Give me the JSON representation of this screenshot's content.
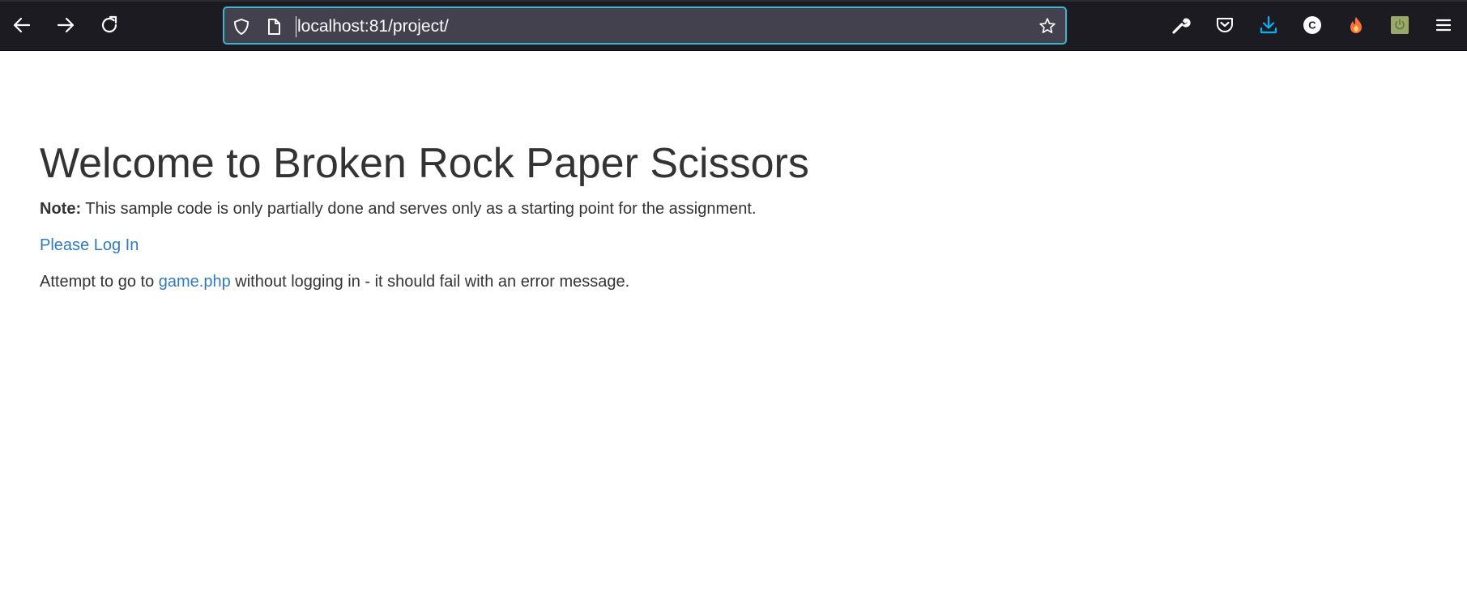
{
  "browser": {
    "url": "localhost:81/project/",
    "icons": {
      "back": "arrow-left-icon",
      "forward": "arrow-right-icon",
      "reload": "reload-icon",
      "shield": "shield-icon",
      "page": "page-icon",
      "bookmark": "star-icon",
      "tools": "wrench-icon",
      "pocket": "pocket-icon",
      "downloads": "download-icon",
      "extension_c": "c-extension-icon",
      "extension_fire": "fire-extension-icon",
      "extension_power": "power-extension-icon",
      "menu": "hamburger-menu-icon"
    },
    "colors": {
      "toolbar_bg": "#1c1b22",
      "urlbar_bg": "#42414d",
      "urlbar_focus": "#3fb3cf",
      "download_accent": "#00b3f4"
    }
  },
  "page": {
    "title": "Welcome to Broken Rock Paper Scissors",
    "note_label": "Note:",
    "note_text": " This sample code is only partially done and serves only as a starting point for the assignment.",
    "login_link": "Please Log In",
    "attempt_prefix": "Attempt to go to ",
    "game_link": "game.php",
    "attempt_suffix": " without logging in - it should fail with an error message.",
    "colors": {
      "text": "#333333",
      "link": "#337ab7"
    }
  }
}
